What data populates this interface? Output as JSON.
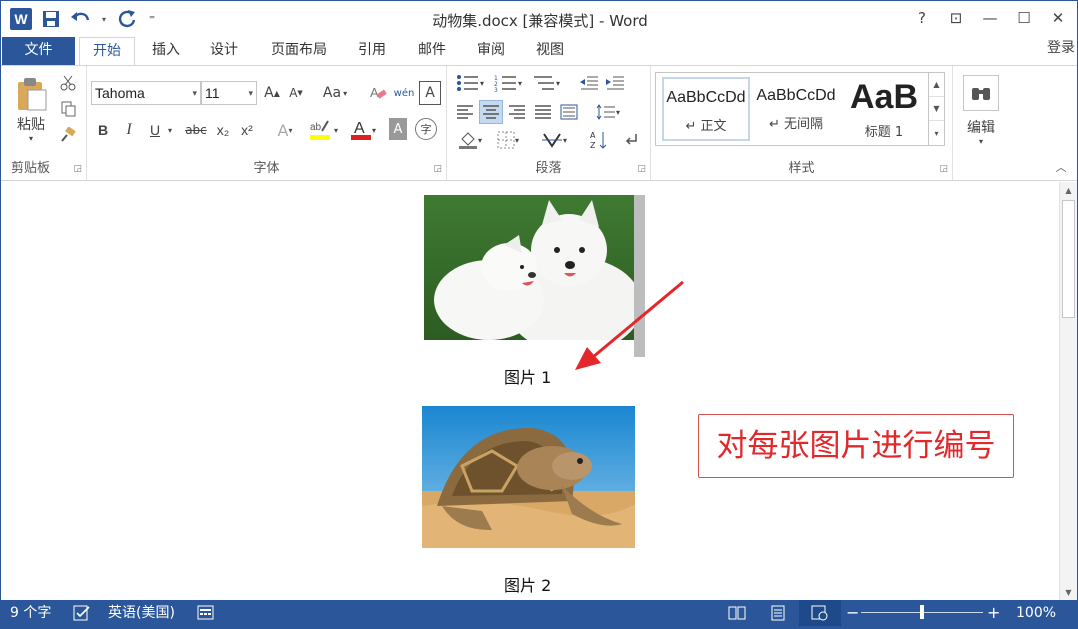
{
  "titlebar": {
    "app_icon": "W",
    "title": "动物集.docx [兼容模式] - Word",
    "help": "?",
    "ribbon_display": "⊡",
    "minimize": "—",
    "maximize": "☐",
    "close": "✕"
  },
  "qat": {
    "save_icon": "save-icon",
    "undo_icon": "undo-icon",
    "redo_icon": "redo-icon",
    "customize": "⁼"
  },
  "tabs": {
    "file": "文件",
    "home": "开始",
    "insert": "插入",
    "design": "设计",
    "layout": "页面布局",
    "references": "引用",
    "mailings": "邮件",
    "review": "审阅",
    "view": "视图",
    "login": "登录"
  },
  "clipboard": {
    "paste": "粘贴",
    "label": "剪贴板"
  },
  "font": {
    "name": "Tahoma",
    "size": "11",
    "bold": "B",
    "italic": "I",
    "underline": "U",
    "strike": "abc",
    "subscript": "x₂",
    "superscript": "x²",
    "grow": "A",
    "shrink": "A",
    "case": "Aa",
    "label": "字体",
    "font_color_accent": "#e02020",
    "highlight_accent": "#ffff00"
  },
  "paragraph": {
    "label": "段落"
  },
  "styles": {
    "items": [
      {
        "sample": "AaBbCcDd",
        "name": "↵ 正文"
      },
      {
        "sample": "AaBbCcDd",
        "name": "↵ 无间隔"
      },
      {
        "sample": "AaB",
        "name": "标题 1"
      }
    ],
    "label": "样式"
  },
  "editing": {
    "label": "编辑"
  },
  "document": {
    "caption_1": "图片 1",
    "caption_2": "图片 2",
    "annotation": "对每张图片进行编号",
    "annotation_color": "#e3282b"
  },
  "statusbar": {
    "word_count": "9 个字",
    "language": "英语(美国)",
    "zoom": "100%",
    "zoom_level": 1.0
  }
}
